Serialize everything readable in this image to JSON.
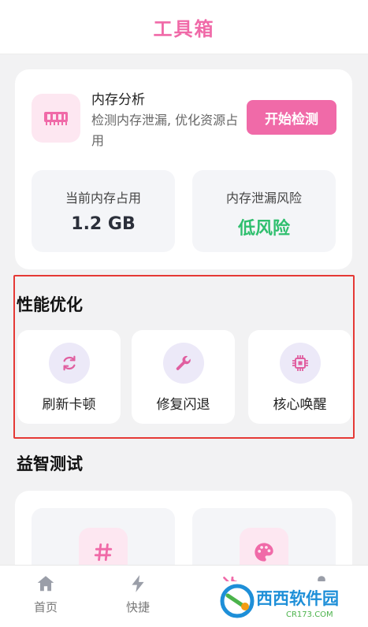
{
  "header": {
    "title": "工具箱"
  },
  "memory": {
    "title": "内存分析",
    "description": "检测内存泄漏, 优化资源占用",
    "start_button": "开始检测",
    "stats": [
      {
        "label": "当前内存占用",
        "value": "1.2 GB"
      },
      {
        "label": "内存泄漏风险",
        "value": "低风险"
      }
    ]
  },
  "performance": {
    "title": "性能优化",
    "tools": [
      {
        "label": "刷新卡顿",
        "icon": "refresh-icon"
      },
      {
        "label": "修复闪退",
        "icon": "wrench-icon"
      },
      {
        "label": "核心唤醒",
        "icon": "chip-icon"
      }
    ]
  },
  "puzzle": {
    "title": "益智测试",
    "tiles": [
      {
        "icon": "hash-icon"
      },
      {
        "icon": "palette-icon"
      }
    ]
  },
  "nav": {
    "items": [
      {
        "label": "首页",
        "icon": "home-icon"
      },
      {
        "label": "快捷",
        "icon": "lightning-icon"
      },
      {
        "label": "",
        "icon": "tools-icon"
      },
      {
        "label": "",
        "icon": "user-icon"
      }
    ]
  },
  "watermark": {
    "text": "西西软件园",
    "subtext": "CR173.COM"
  },
  "colors": {
    "accent": "#f06aa8",
    "success": "#2fbf6e",
    "highlight_border": "#e53935"
  }
}
